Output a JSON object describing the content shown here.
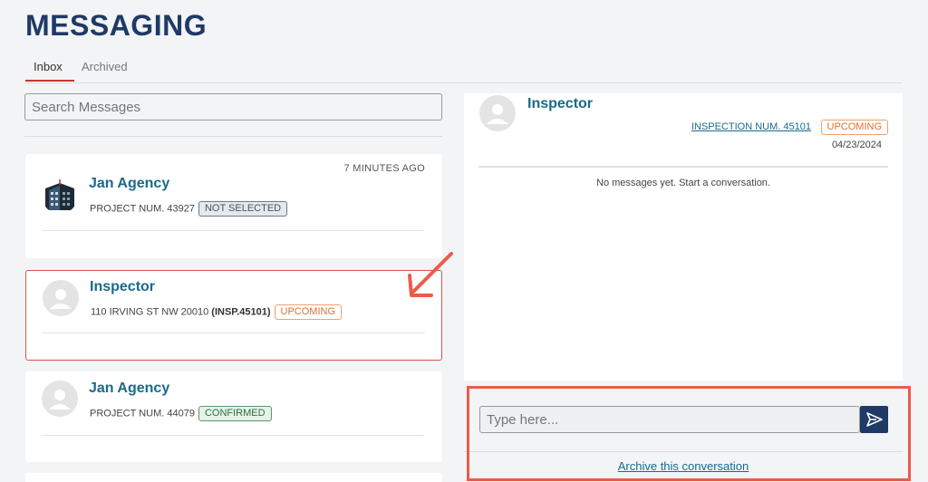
{
  "page": {
    "title": "MESSAGING"
  },
  "tabs": [
    {
      "label": "Inbox",
      "active": true
    },
    {
      "label": "Archived",
      "active": false
    }
  ],
  "search": {
    "placeholder": "Search Messages"
  },
  "conversations": [
    {
      "name": "Jan Agency",
      "time": "7 MINUTES AGO",
      "subtitle": "PROJECT NUM. 43927",
      "subtitle_bold": "",
      "badge": "NOT SELECTED",
      "badge_style": "gray",
      "avatar": "building-logo"
    },
    {
      "name": "Inspector",
      "time": "",
      "subtitle": "110 IRVING ST NW 20010 ",
      "subtitle_bold": "(INSP.45101)",
      "badge": "UPCOMING",
      "badge_style": "orange",
      "avatar": "user-placeholder",
      "selected": true
    },
    {
      "name": "Jan Agency",
      "time": "",
      "subtitle": "PROJECT NUM. 44079",
      "subtitle_bold": "",
      "badge": "CONFIRMED",
      "badge_style": "green",
      "avatar": "user-placeholder"
    }
  ],
  "detail": {
    "name": "Inspector",
    "inspection_link": "INSPECTION NUM. 45101",
    "status": "UPCOMING",
    "date": "04/23/2024",
    "empty_message": "No messages yet. Start a conversation."
  },
  "compose": {
    "placeholder": "Type here...",
    "send_icon": "send-icon",
    "archive_label": "Archive this conversation"
  },
  "colors": {
    "brand_navy": "#1f3a66",
    "name_teal": "#1a6a8a",
    "annotation_red": "#ee5a4a"
  }
}
